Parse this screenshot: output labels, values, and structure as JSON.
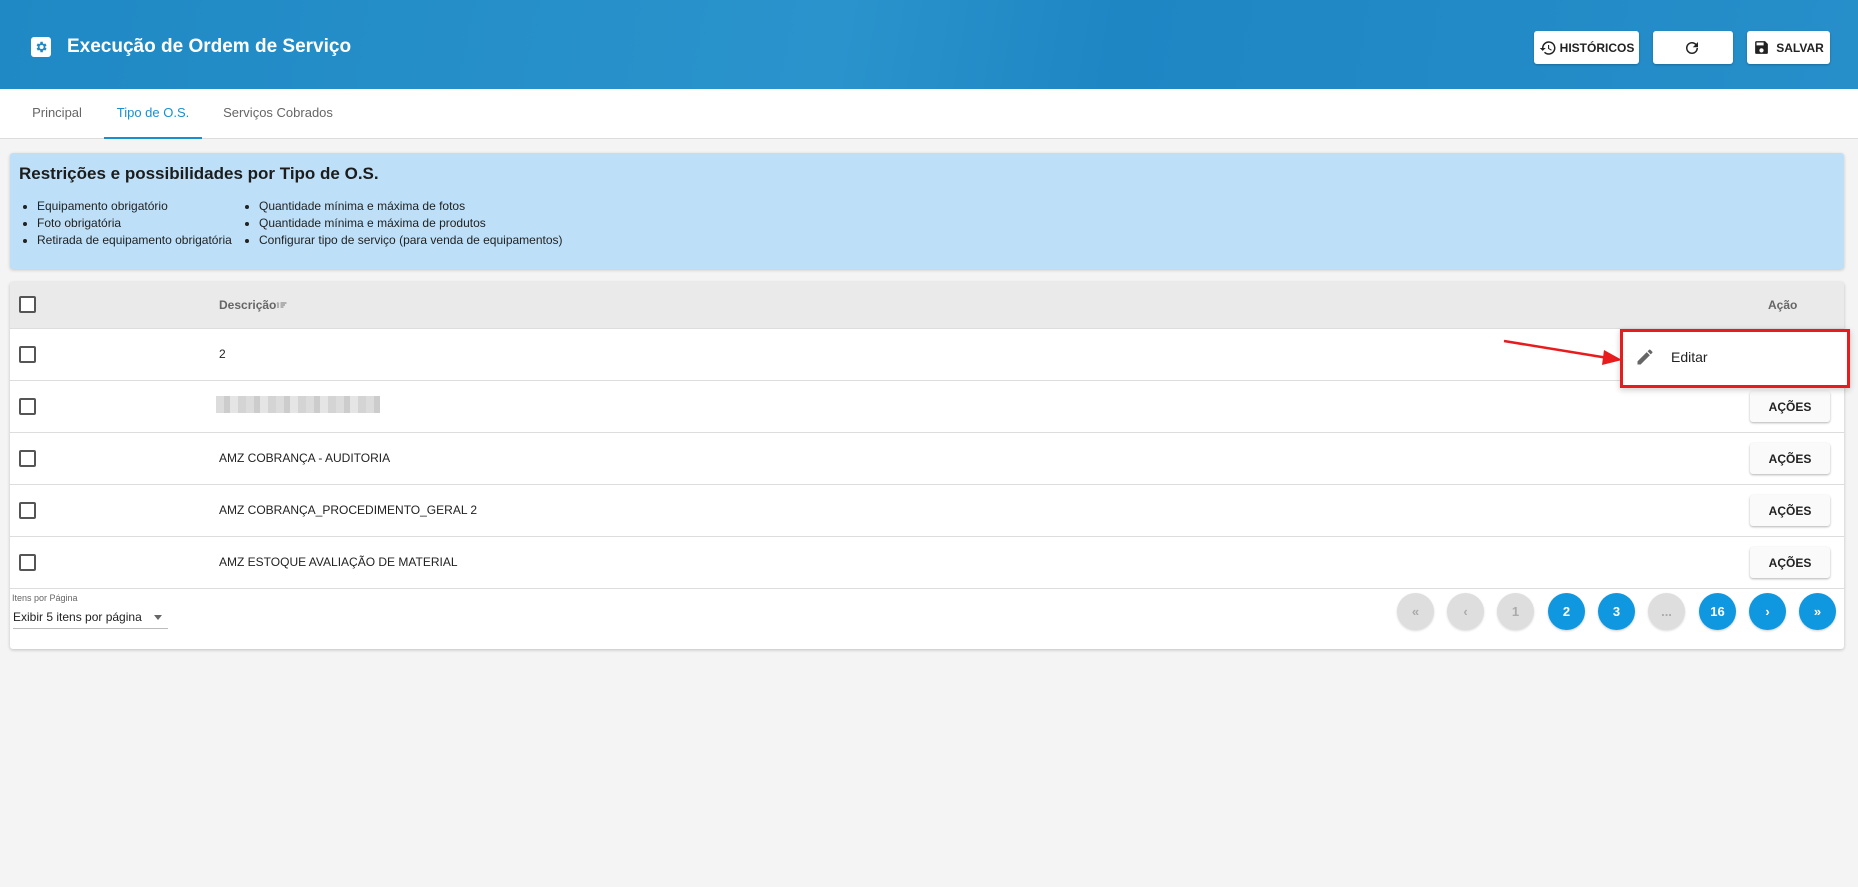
{
  "header": {
    "title": "Execução de Ordem de Serviço",
    "historicos_label": "HISTÓRICOS",
    "salvar_label": "SALVAR"
  },
  "tabs": [
    {
      "label": "Principal"
    },
    {
      "label": "Tipo de O.S."
    },
    {
      "label": "Serviços Cobrados"
    }
  ],
  "info": {
    "title": "Restrições e possibilidades por Tipo de O.S.",
    "col1": [
      "Equipamento obrigatório",
      "Foto obrigatória",
      "Retirada de equipamento obrigatória"
    ],
    "col2": [
      "Quantidade mínima e máxima de fotos",
      "Quantidade mínima e máxima de produtos",
      "Configurar tipo de serviço (para venda de equipamentos)"
    ]
  },
  "table": {
    "headers": {
      "descricao": "Descrição",
      "acao": "Ação"
    },
    "action_label": "AÇÕES",
    "rows": [
      {
        "descricao": "2"
      },
      {
        "descricao": ""
      },
      {
        "descricao": "AMZ COBRANÇA - AUDITORIA"
      },
      {
        "descricao": "AMZ COBRANÇA_PROCEDIMENTO_GERAL 2"
      },
      {
        "descricao": "AMZ ESTOQUE AVALIAÇÃO DE MATERIAL"
      }
    ]
  },
  "pagination": {
    "per_page_label": "Itens por Página",
    "per_page_value": "Exibir 5 itens por página",
    "first": "«",
    "prev": "‹",
    "pages": [
      "1",
      "2",
      "3",
      "...",
      "16"
    ],
    "next": "›",
    "last": "»",
    "current_page": "1"
  },
  "context_menu": {
    "edit_label": "Editar"
  },
  "colors": {
    "header_blue": "#1f89c5",
    "accent": "#1a8fd0",
    "info_bg": "#bde0f8",
    "highlight_red": "#e81c1c"
  }
}
